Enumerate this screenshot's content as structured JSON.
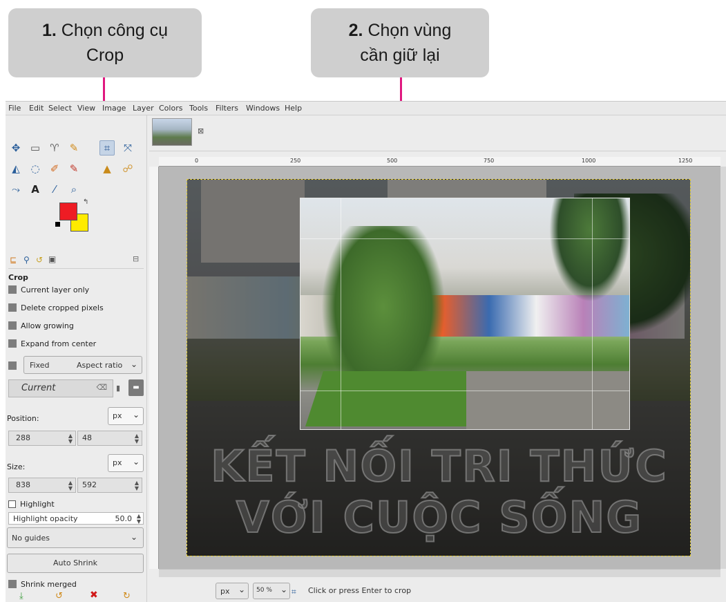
{
  "callouts": {
    "step1": {
      "number": "1.",
      "line1": "Chọn công cụ",
      "line2": "Crop"
    },
    "step2": {
      "number": "2.",
      "line1": "Chọn vùng",
      "line2": "cần giữ lại"
    }
  },
  "colors": {
    "arrow": "#e0187f",
    "callout_bg": "#cfcfcf",
    "fg_color": "#ee1c24",
    "bg_color": "#ffeb00"
  },
  "menu": [
    "File",
    "Edit",
    "Select",
    "View",
    "Image",
    "Layer",
    "Colors",
    "Tools",
    "Filters",
    "Windows",
    "Help"
  ],
  "tools": {
    "row1": [
      "move-icon",
      "rect-select-icon",
      "free-select-icon",
      "fuzzy-select-icon",
      "crop-icon",
      "unified-transform-icon"
    ],
    "row2": [
      "warp-icon",
      "bucket-fill-icon",
      "paintbrush-icon",
      "pencil-icon",
      "clone-icon",
      "smudge-icon"
    ],
    "row3": [
      "paths-icon",
      "text-icon",
      "color-picker-icon",
      "zoom-icon"
    ]
  },
  "tool_options": {
    "title": "Crop",
    "current_layer_only": "Current layer only",
    "delete_cropped_pixels": "Delete cropped pixels",
    "allow_growing": "Allow growing",
    "expand_from_center": "Expand from center",
    "fixed_label": "Fixed",
    "aspect_ratio": "Aspect ratio",
    "current": "Current",
    "position_label": "Position:",
    "position_unit": "px",
    "position_x": "288",
    "position_y": "48",
    "size_label": "Size:",
    "size_unit": "px",
    "size_w": "838",
    "size_h": "592",
    "highlight": "Highlight",
    "highlight_opacity_label": "Highlight opacity",
    "highlight_opacity_value": "50.0",
    "guides": "No guides",
    "auto_shrink": "Auto Shrink",
    "shrink_merged": "Shrink merged"
  },
  "ruler_labels": [
    "0",
    "250",
    "500",
    "750",
    "1000",
    "1250"
  ],
  "watermark": {
    "line1": "KẾT NỐI TRI THỨC",
    "line2": "VỚI CUỘC SỐNG"
  },
  "status": {
    "unit": "px",
    "zoom": "50 %",
    "message": "Click or press Enter to crop"
  }
}
